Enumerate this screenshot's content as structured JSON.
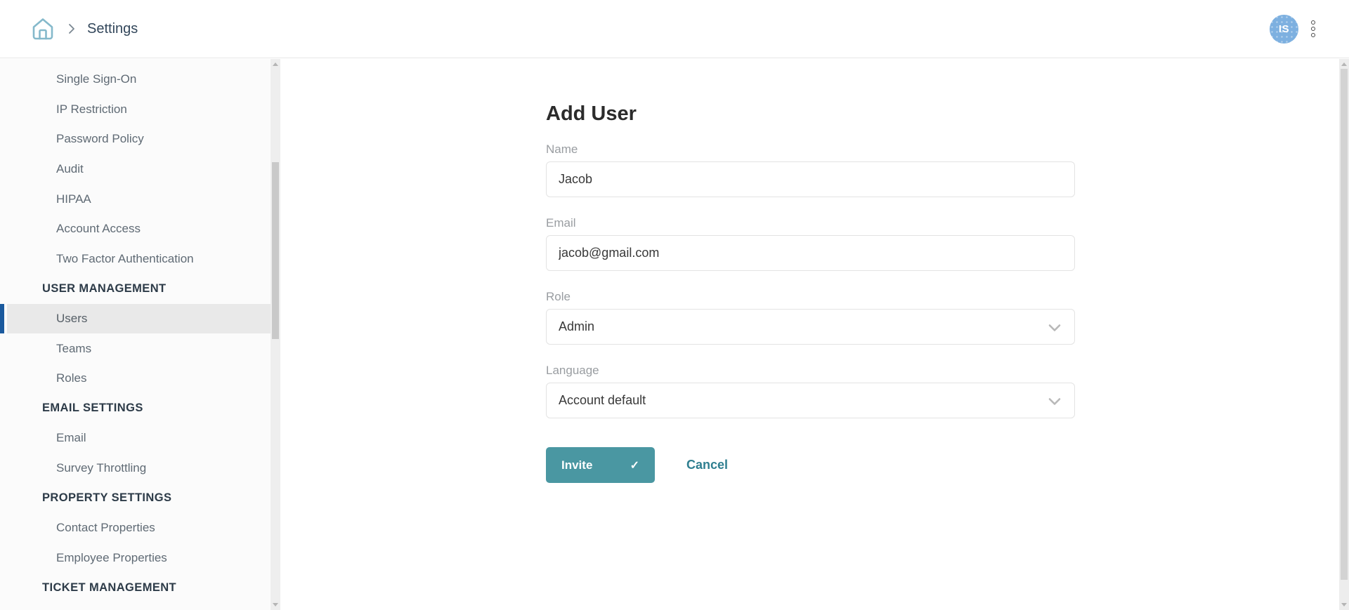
{
  "header": {
    "breadcrumb": {
      "current": "Settings"
    },
    "avatar_initials": "IS"
  },
  "sidebar": {
    "items": [
      {
        "type": "item",
        "label": "Single Sign-On"
      },
      {
        "type": "item",
        "label": "IP Restriction"
      },
      {
        "type": "item",
        "label": "Password Policy"
      },
      {
        "type": "item",
        "label": "Audit"
      },
      {
        "type": "item",
        "label": "HIPAA"
      },
      {
        "type": "item",
        "label": "Account Access"
      },
      {
        "type": "item",
        "label": "Two Factor Authentication"
      },
      {
        "type": "header",
        "label": "USER MANAGEMENT"
      },
      {
        "type": "item",
        "label": "Users",
        "selected": true
      },
      {
        "type": "item",
        "label": "Teams"
      },
      {
        "type": "item",
        "label": "Roles"
      },
      {
        "type": "header",
        "label": "EMAIL SETTINGS"
      },
      {
        "type": "item",
        "label": "Email"
      },
      {
        "type": "item",
        "label": "Survey Throttling"
      },
      {
        "type": "header",
        "label": "PROPERTY SETTINGS"
      },
      {
        "type": "item",
        "label": "Contact Properties"
      },
      {
        "type": "item",
        "label": "Employee Properties"
      },
      {
        "type": "header",
        "label": "TICKET MANAGEMENT"
      }
    ]
  },
  "main": {
    "title": "Add User",
    "fields": [
      {
        "label": "Name",
        "value": "Jacob",
        "type": "text"
      },
      {
        "label": "Email",
        "value": "jacob@gmail.com",
        "type": "text"
      },
      {
        "label": "Role",
        "value": "Admin",
        "type": "select"
      },
      {
        "label": "Language",
        "value": "Account default",
        "type": "select"
      }
    ],
    "invite_label": "Invite",
    "check_glyph": "✓",
    "cancel_label": "Cancel"
  },
  "colors": {
    "accent_teal": "#4a97a2",
    "link_teal": "#2f7f90",
    "selected_bar_blue": "#1b5a9e",
    "header_text": "#33475b",
    "home_icon": "#85b9cb",
    "avatar_blue": "#7db0e0"
  }
}
